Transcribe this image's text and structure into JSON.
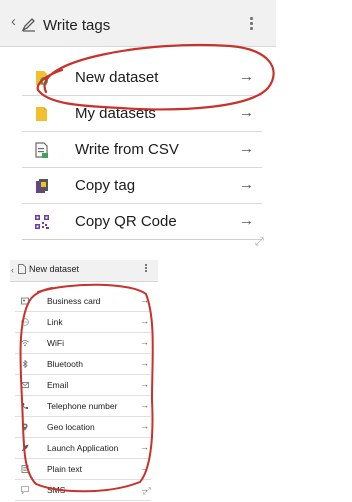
{
  "top": {
    "back": "‹",
    "title": "Write tags",
    "items": [
      {
        "label": "New dataset",
        "arrow": "→"
      },
      {
        "label": "My datasets",
        "arrow": "→"
      },
      {
        "label": "Write from CSV",
        "arrow": "→"
      },
      {
        "label": "Copy tag",
        "arrow": "→"
      },
      {
        "label": "Copy QR Code",
        "arrow": "→"
      }
    ],
    "resize": "⤢"
  },
  "bottom": {
    "back": "‹",
    "title": "New dataset",
    "items": [
      {
        "label": "Business card",
        "arrow": "→"
      },
      {
        "label": "Link",
        "arrow": "→"
      },
      {
        "label": "WiFi",
        "arrow": "→"
      },
      {
        "label": "Bluetooth",
        "arrow": "→"
      },
      {
        "label": "Email",
        "arrow": "→"
      },
      {
        "label": "Telephone number",
        "arrow": "→"
      },
      {
        "label": "Geo location",
        "arrow": "→"
      },
      {
        "label": "Launch Application",
        "arrow": "→"
      },
      {
        "label": "Plain text",
        "arrow": "→"
      },
      {
        "label": "SMS",
        "arrow": "→"
      }
    ],
    "resize": "⤢"
  },
  "colors": {
    "annotation_red": "#c8322a",
    "folder_yellow": "#f2c02e",
    "plus_green": "#3aa757",
    "icon_gray": "#6b6b6b",
    "icon_purple": "#6b3fa0"
  }
}
